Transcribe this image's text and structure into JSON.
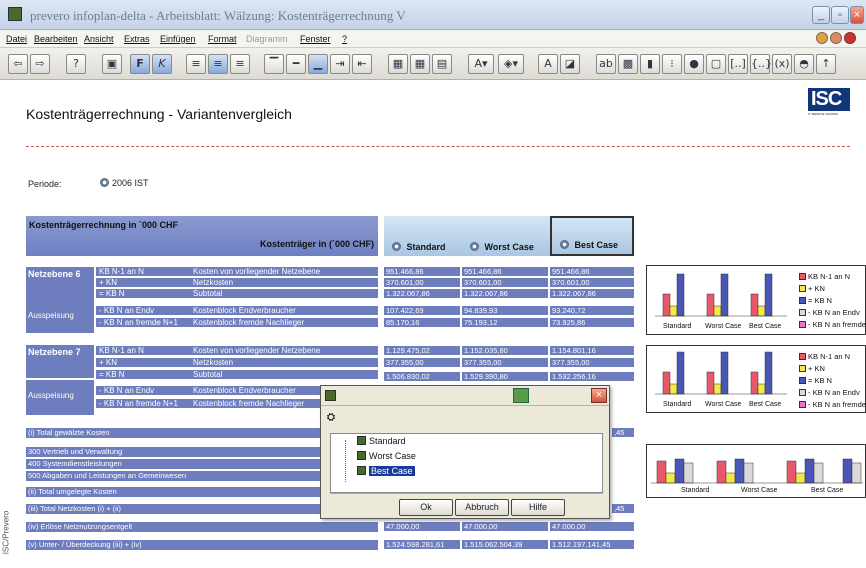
{
  "window": {
    "title": "prevero infoplan-delta - Arbeitsblatt: Wälzung: Kostenträgerrechnung V"
  },
  "menu": {
    "items": [
      "Datei",
      "Bearbeiten",
      "Ansicht",
      "Extras",
      "Einfügen",
      "Format",
      "Diagramm",
      "Fenster",
      "?"
    ]
  },
  "page": {
    "title": "Kostenträgerrechnung - Variantenvergleich",
    "logo_text": "ISC",
    "logo_sub": "IT SERVICE CENTER",
    "periode_label": "Periode:",
    "periode_value": "2006 IST"
  },
  "table": {
    "header_title": "Kostenträgerrechnung in `000 CHF",
    "header_sub": "Kostenträger in (`000 CHF)",
    "columns": [
      "Standard",
      "Worst Case",
      "Best Case"
    ],
    "netz6": {
      "label": "Netzebene 6",
      "rows": [
        {
          "a": "KB N-1 an N",
          "b": "Kosten von vorliegender Netzebene",
          "v": [
            "951.466,86",
            "951.466,86",
            "951.466,86"
          ]
        },
        {
          "a": "+ KN",
          "b": "Netzkosten",
          "v": [
            "370.601,00",
            "370.601,00",
            "370.601,00"
          ]
        },
        {
          "a": "= KB N",
          "b": "Subtotal",
          "v": [
            "1.322.067,86",
            "1.322.067,86",
            "1.322.067,86"
          ]
        }
      ],
      "ausspeisung_label": "Ausspeisung",
      "aus_rows": [
        {
          "a": "- KB N an Endv",
          "b": "Kostenblock Endverbraucher",
          "v": [
            "107.422,69",
            "94.839,93",
            "93.240,72"
          ]
        },
        {
          "a": "- KB N an fremde N+1",
          "b": "Kostenblock fremde Nachlieger",
          "v": [
            "85.170,16",
            "75.193,12",
            "73.925,86"
          ]
        }
      ]
    },
    "netz7": {
      "label": "Netzebene 7",
      "rows": [
        {
          "a": "KB N-1 an N",
          "b": "Kosten von vorliegender Netzebene",
          "v": [
            "1.129.475,02",
            "1.152.035,80",
            "1.154.801,16"
          ]
        },
        {
          "a": "+ KN",
          "b": "Netzkosten",
          "v": [
            "377.355,00",
            "377.355,00",
            "377.355,00"
          ]
        },
        {
          "a": "= KB N",
          "b": "Subtotal",
          "v": [
            "1.506.830,02",
            "1.529.390,80",
            "1.532.256,16"
          ]
        }
      ],
      "ausspeisung_label": "Ausspeisung",
      "aus_rows": [
        {
          "a": "- KB N an Endv",
          "b": "Kostenblock Endverbraucher"
        },
        {
          "a": "- KB N an fremde N+1",
          "b": "Kostenblock fremde Nachlieger"
        }
      ]
    },
    "totals": [
      "(i) Total gewälzte Kosten",
      "300 Vertrieb und Verwaltung",
      "400 Systemdienstleistungen",
      "500 Abgaben und Leistungen an Gemeinwesen",
      "(ii) Total umgelegte Kosten",
      "(iii) Total Netzkosten (i) + (ii)",
      "(iv) Erlöse Netznutzungsentgelt",
      "(v) Unter- / Überdeckung (iii) + (iv)"
    ],
    "partial_values": [
      ",45",
      ",45"
    ],
    "erloese_values": [
      "47.000,00",
      "47.000,00",
      "47.000,00"
    ],
    "ueberdeckung_values": [
      "1.524.598.281,61",
      "1.515.062.504,39",
      "1.512.197.141,45"
    ]
  },
  "legend": {
    "items": [
      "KB N-1 an N",
      "+ KN",
      "= KB N",
      "- KB N an Endv",
      "- KB N an fremde"
    ],
    "colors": [
      "#e8586a",
      "#f2e84a",
      "#4a55b8",
      "#d9d9d9",
      "#e07ad0"
    ]
  },
  "mini_charts": {
    "categories": [
      "Standard",
      "Worst Case",
      "Best Case"
    ]
  },
  "dialog": {
    "items": [
      "Standard",
      "Worst Case",
      "Best Case"
    ],
    "selected": "Best Case",
    "ok": "Ok",
    "cancel": "Abbruch",
    "help": "Hilfe"
  },
  "credit": "ISC/Prevero"
}
